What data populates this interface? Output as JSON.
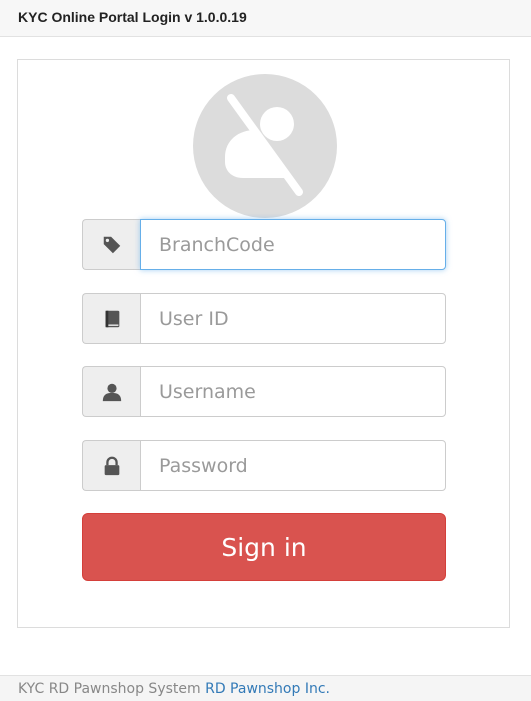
{
  "window": {
    "title": "KYC Online Portal Login v 1.0.0.19"
  },
  "avatar": {
    "icon": "no-user-icon"
  },
  "fields": [
    {
      "name": "branchcode",
      "icon": "tag-icon",
      "placeholder": "BranchCode",
      "value": "",
      "focused": true
    },
    {
      "name": "userid",
      "icon": "book-icon",
      "placeholder": "User ID",
      "value": ""
    },
    {
      "name": "username",
      "icon": "user-icon",
      "placeholder": "Username",
      "value": ""
    },
    {
      "name": "password",
      "icon": "lock-icon",
      "placeholder": "Password",
      "value": ""
    }
  ],
  "signin": {
    "label": "Sign in",
    "color": "#d9534f"
  },
  "footer": {
    "text": "KYC RD Pawnshop System ",
    "link": "RD Pawnshop Inc."
  }
}
